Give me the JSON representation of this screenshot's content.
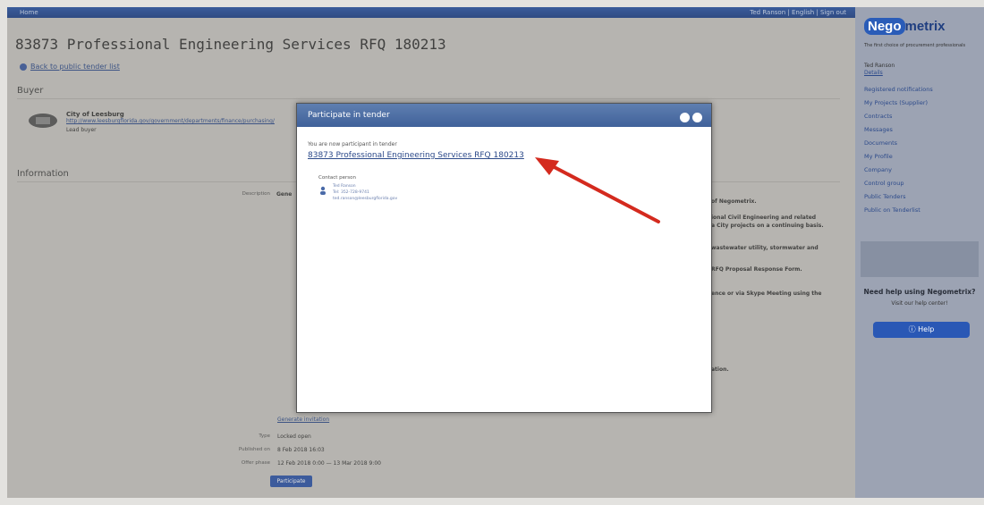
{
  "topbar": {
    "left": "Home",
    "right": "Ted Ranson | English | Sign out"
  },
  "page": {
    "title": "83873 Professional Engineering Services RFQ 180213",
    "back_link": "Back to public tender list",
    "buyer_heading": "Buyer",
    "buyer": {
      "name": "City of Leesburg",
      "url": "http://www.leesburgflorida.gov/government/departments/finance/purchasing/",
      "subtitle": "Lead buyer"
    },
    "info_heading": "Information",
    "fields": {
      "description_label": "Description",
      "type_label": "Type",
      "type_value": "Locked open",
      "published_label": "Published on",
      "published_value": "8 Feb 2018 16:03",
      "offer_label": "Offer phase",
      "offer_value": "12 Feb 2018 0:00 — 13 Mar 2018 9:00",
      "invitation_label": "Generate invitation"
    },
    "participate_label": "Participate"
  },
  "sidebar": {
    "logo_a": "Nego",
    "logo_b": "metrix",
    "tagline": "The first choice of procurement professionals",
    "user": "Ted Ranson",
    "user_link": "Details",
    "nav": [
      "Registered notifications",
      "My Projects (Supplier)",
      "Contracts",
      "Messages",
      "Documents",
      "My Profile",
      "Company",
      "Control group",
      "Public Tenders",
      "Public on Tenderlist"
    ],
    "help_question": "Need help using Negometrix?",
    "help_sub": "Visit our help center!",
    "help_button": "Help"
  },
  "modal": {
    "title": "Participate in tender",
    "note": "You are now participant in tender",
    "tender_link": "83873 Professional Engineering Services RFQ 180213",
    "contact_heading": "Contact person",
    "contact_lines": [
      "Ted Ranson",
      "Tel: 352-728-9741",
      "ted.ranson@leesburgflorida.gov"
    ]
  },
  "colors": {
    "arrow": "#d42a1e",
    "accent": "#2a58b5"
  }
}
